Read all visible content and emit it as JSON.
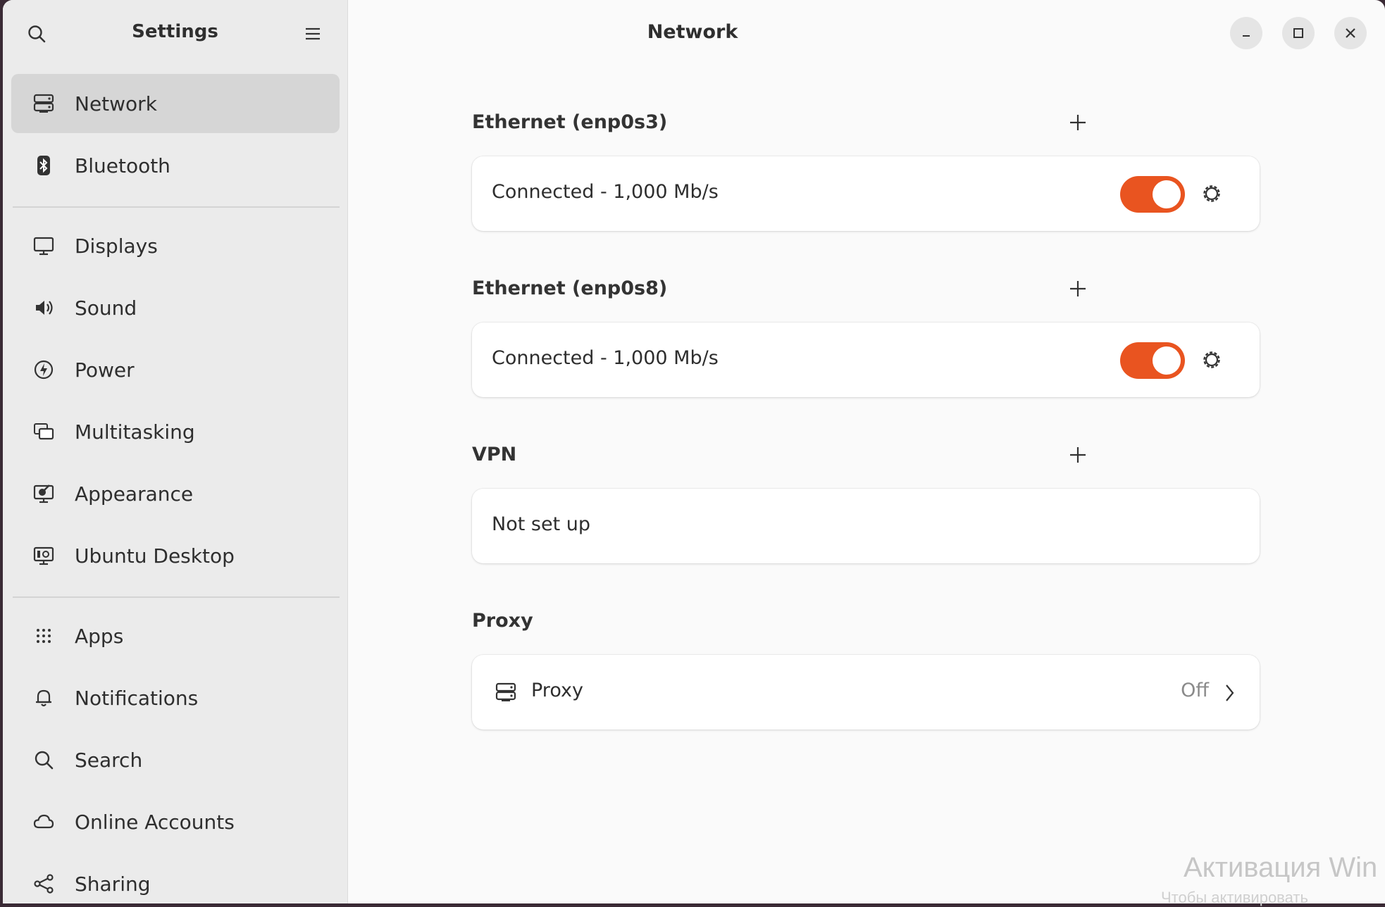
{
  "window": {
    "title": "Network"
  },
  "sidebar": {
    "title": "Settings",
    "items": [
      {
        "label": "Network",
        "icon": "network-icon"
      },
      {
        "label": "Bluetooth",
        "icon": "bluetooth-icon"
      },
      {
        "label": "Displays",
        "icon": "display-icon"
      },
      {
        "label": "Sound",
        "icon": "speaker-icon"
      },
      {
        "label": "Power",
        "icon": "power-icon"
      },
      {
        "label": "Multitasking",
        "icon": "multitasking-icon"
      },
      {
        "label": "Appearance",
        "icon": "appearance-icon"
      },
      {
        "label": "Ubuntu Desktop",
        "icon": "ubuntu-desktop-icon"
      },
      {
        "label": "Apps",
        "icon": "apps-grid-icon"
      },
      {
        "label": "Notifications",
        "icon": "bell-icon"
      },
      {
        "label": "Search",
        "icon": "search-icon"
      },
      {
        "label": "Online Accounts",
        "icon": "cloud-icon"
      },
      {
        "label": "Sharing",
        "icon": "share-icon"
      }
    ]
  },
  "main": {
    "sections": [
      {
        "title": "Ethernet (enp0s3)",
        "status": "Connected - 1,000 Mb/s",
        "enabled": true
      },
      {
        "title": "Ethernet (enp0s8)",
        "status": "Connected - 1,000 Mb/s",
        "enabled": true
      },
      {
        "title": "VPN",
        "status": "Not set up"
      }
    ],
    "proxy": {
      "title": "Proxy",
      "label": "Proxy",
      "status": "Off"
    }
  },
  "watermark": {
    "line1": "Активация Win",
    "line2": "Чтобы активировать"
  },
  "colors": {
    "accent": "#e95420",
    "sidebar_bg": "#ebebeb",
    "content_bg": "#fafafa"
  }
}
